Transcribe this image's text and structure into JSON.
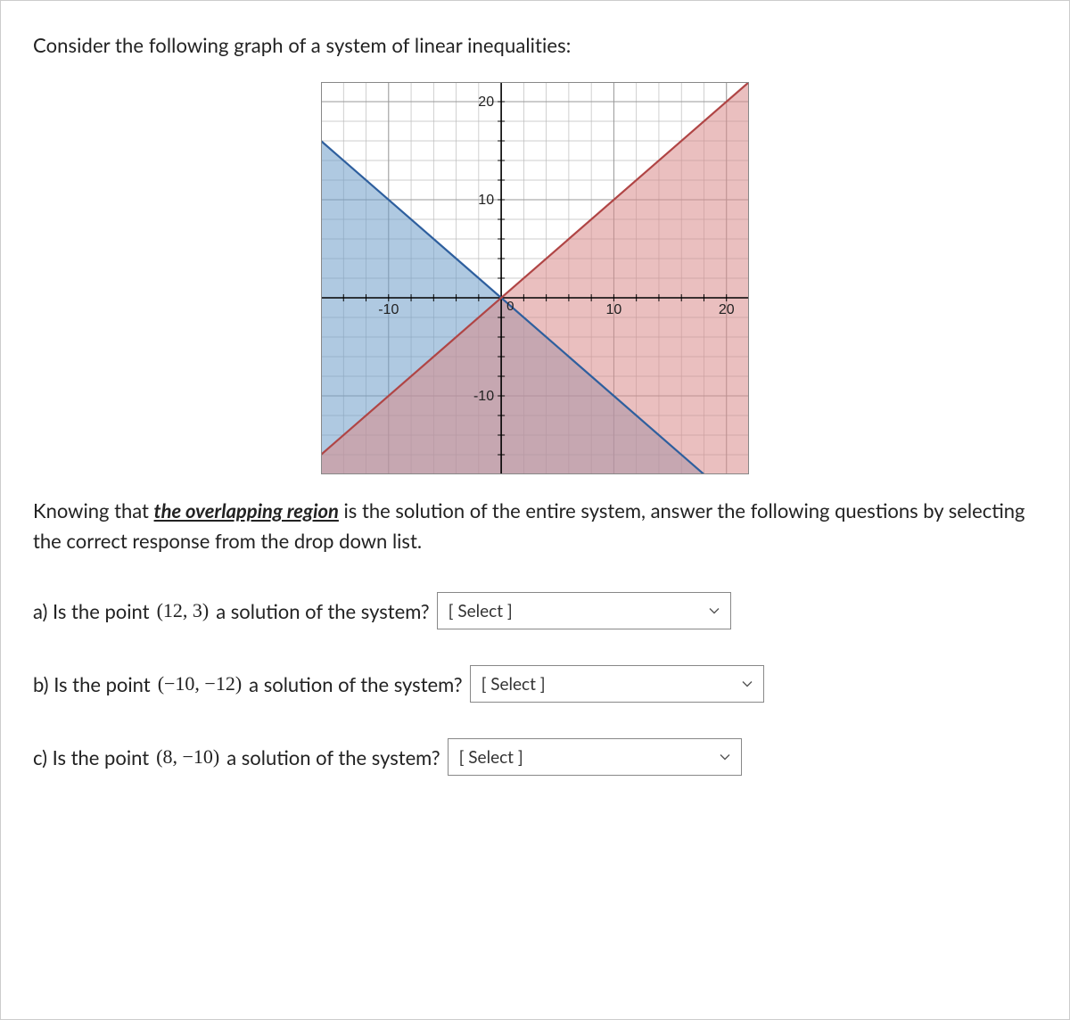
{
  "prompt_top": "Consider the following graph of a system of linear inequalities:",
  "explain_pre": "Knowing that ",
  "explain_emph": "the overlapping region",
  "explain_post": " is the solution of the entire system, answer the following questions by selecting the correct response from the drop down list.",
  "questions": {
    "a": {
      "label_pre": "a) Is the point  ",
      "point": "(12, 3)",
      "label_post": "  a solution of the system?",
      "select_placeholder": "[ Select ]"
    },
    "b": {
      "label_pre": "b) Is the point  ",
      "point": "(−10, −12)",
      "label_post": "  a solution of the system?",
      "select_placeholder": "[ Select ]"
    },
    "c": {
      "label_pre": "c) Is the point   ",
      "point": "(8, −10)",
      "label_post": "  a solution of the system?",
      "select_placeholder": "[ Select ]"
    }
  },
  "chart_data": {
    "type": "area",
    "title": "",
    "xlabel": "",
    "ylabel": "",
    "xlim": [
      -16,
      22
    ],
    "ylim": [
      -18,
      22
    ],
    "x_ticks": [
      -10,
      0,
      10,
      20
    ],
    "y_ticks": [
      -10,
      10,
      20
    ],
    "x_tick_labels": [
      "-10",
      "0",
      "10",
      "20"
    ],
    "y_tick_labels": [
      "-10",
      "10",
      "20"
    ],
    "grid_step": 2,
    "grid": true,
    "series": [
      {
        "name": "blue_region",
        "inequality": "y ≤ -x",
        "boundary_line": {
          "type": "line",
          "slope": -1,
          "intercept": 0,
          "style": "solid"
        },
        "fill_color": "#6e9cc9",
        "fill_opacity": 0.55
      },
      {
        "name": "red_region",
        "inequality": "y ≤ x",
        "boundary_line": {
          "type": "line",
          "slope": 1,
          "intercept": 0,
          "style": "solid"
        },
        "fill_color": "#d98a8a",
        "fill_opacity": 0.55
      }
    ],
    "overlap_note": "purple region where both shaded areas intersect (below both lines)"
  }
}
